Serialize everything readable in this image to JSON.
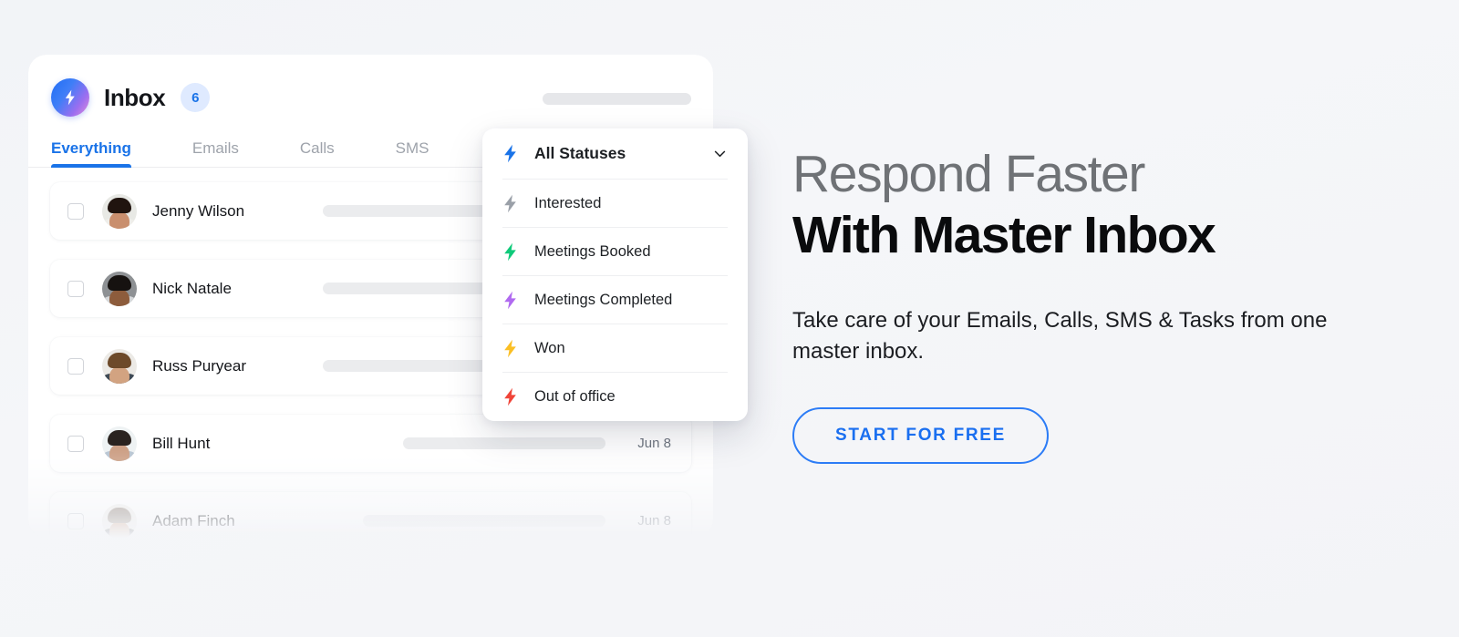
{
  "brand": {
    "logo_icon": "lightning-bolt-icon"
  },
  "app": {
    "title": "Inbox",
    "badge_count": "6",
    "tabs": [
      {
        "label": "Everything",
        "active": true
      },
      {
        "label": "Emails",
        "active": false
      },
      {
        "label": "Calls",
        "active": false
      },
      {
        "label": "SMS",
        "active": false
      }
    ],
    "rows": [
      {
        "name": "Jenny Wilson",
        "date": "",
        "skeleton_width": 310,
        "hair": "#20140f",
        "skin": "#c98f6e",
        "shirt": "#efeeea",
        "bg": "#e8e9e5"
      },
      {
        "name": "Nick Natale",
        "date": "",
        "skeleton_width": 310,
        "hair": "#161210",
        "skin": "#8d5c3c",
        "shirt": "#d6d8da",
        "bg": "#8e9194"
      },
      {
        "name": "Russ Puryear",
        "date": "",
        "skeleton_width": 310,
        "hair": "#6d4a2a",
        "skin": "#d2a381",
        "shirt": "#3f4a55",
        "bg": "#eceae6"
      },
      {
        "name": "Bill Hunt",
        "date": "Jun 8",
        "skeleton_width": 222,
        "hair": "#2a2320",
        "skin": "#cda187",
        "shirt": "#b9c6d3",
        "bg": "#eef2f3"
      },
      {
        "name": "Adam Finch",
        "date": "Jun 8",
        "skeleton_width": 266,
        "hair": "#9a8e85",
        "skin": "#d3a88c",
        "shirt": "#2f3338",
        "bg": "#f0efec"
      }
    ]
  },
  "status_dropdown": {
    "header": {
      "label": "All Statuses",
      "color": "#1a73e8",
      "chevron_icon": "chevron-down-icon"
    },
    "options": [
      {
        "label": "Interested",
        "color": "#9aa0a8"
      },
      {
        "label": "Meetings Booked",
        "color": "#0fca7a"
      },
      {
        "label": "Meetings Completed",
        "color": "#b06af0"
      },
      {
        "label": "Won",
        "color": "#fbbf24"
      },
      {
        "label": "Out of office",
        "color": "#f04438"
      }
    ]
  },
  "marketing": {
    "headline_light": "Respond Faster",
    "headline_bold": "With Master Inbox",
    "subcopy": "Take care of your Emails, Calls, SMS & Tasks from one master inbox.",
    "cta_label": "START FOR FREE",
    "accent_color": "#1a73e8"
  }
}
